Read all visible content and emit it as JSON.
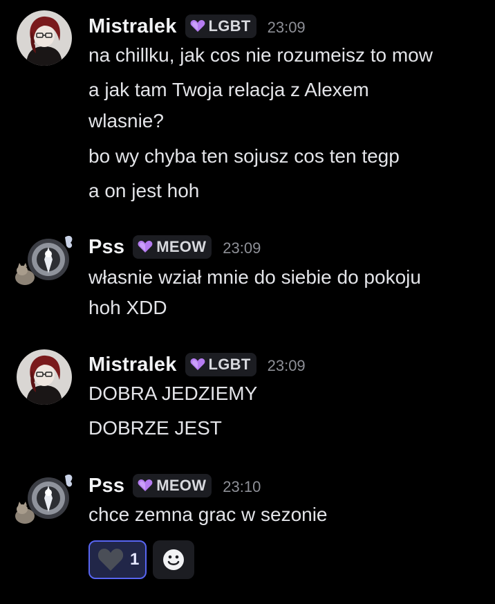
{
  "messages": [
    {
      "username": "Mistralek",
      "tag": "LGBT",
      "timestamp": "23:09",
      "lines": [
        "na chillku, jak cos nie rozumeisz to mow",
        "a jak tam Twoja relacja z Alexem",
        "wlasnie?",
        "bo wy chyba ten sojusz cos ten tegp",
        "a on jest hoh"
      ]
    },
    {
      "username": "Pss",
      "tag": "MEOW",
      "timestamp": "23:09",
      "lines": [
        "własnie wział mnie do siebie do pokoju",
        "hoh XDD"
      ]
    },
    {
      "username": "Mistralek",
      "tag": "LGBT",
      "timestamp": "23:09",
      "lines": [
        "DOBRA JEDZIEMY",
        "DOBRZE JEST"
      ]
    },
    {
      "username": "Pss",
      "tag": "MEOW",
      "timestamp": "23:10",
      "lines": [
        "chce zemna grac w sezonie"
      ]
    }
  ],
  "reaction": {
    "icon": "heart-icon",
    "count": "1"
  },
  "add_reaction_icon": "smiley-icon",
  "colors": {
    "background": "#000000",
    "tag_heart": "#b57cf0",
    "reaction_border": "#5865f2",
    "reaction_bg": "#212648"
  }
}
